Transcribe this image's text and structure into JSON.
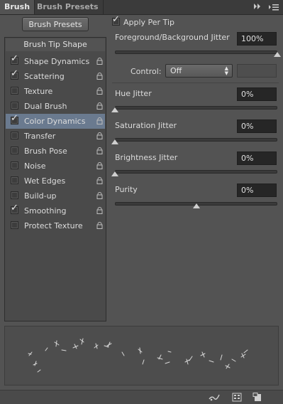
{
  "tabs": [
    {
      "label": "Brush"
    },
    {
      "label": "Brush Presets"
    }
  ],
  "header_icons": [
    "collapse-icon",
    "panel-menu-icon"
  ],
  "brush_presets_button": "Brush Presets",
  "list": {
    "header": "Brush Tip Shape",
    "items": [
      {
        "label": "Shape Dynamics",
        "checked": true,
        "selected": false
      },
      {
        "label": "Scattering",
        "checked": true,
        "selected": false
      },
      {
        "label": "Texture",
        "checked": false,
        "selected": false
      },
      {
        "label": "Dual Brush",
        "checked": false,
        "selected": false
      },
      {
        "label": "Color Dynamics",
        "checked": true,
        "selected": true
      },
      {
        "label": "Transfer",
        "checked": false,
        "selected": false
      },
      {
        "label": "Brush Pose",
        "checked": false,
        "selected": false
      },
      {
        "label": "Noise",
        "checked": false,
        "selected": false
      },
      {
        "label": "Wet Edges",
        "checked": false,
        "selected": false
      },
      {
        "label": "Build-up",
        "checked": false,
        "selected": false
      },
      {
        "label": "Smoothing",
        "checked": true,
        "selected": false
      },
      {
        "label": "Protect Texture",
        "checked": false,
        "selected": false
      }
    ]
  },
  "apply_per_tip": {
    "label": "Apply Per Tip",
    "checked": true
  },
  "fg_bg_jitter": {
    "label": "Foreground/Background Jitter",
    "value": "100%",
    "level": 1.0
  },
  "control": {
    "label": "Control:",
    "selected": "Off"
  },
  "hue_jitter": {
    "label": "Hue Jitter",
    "value": "0%",
    "level": 0.0
  },
  "saturation_jitter": {
    "label": "Saturation Jitter",
    "value": "0%",
    "level": 0.0
  },
  "brightness_jitter": {
    "label": "Brightness Jitter",
    "value": "0%",
    "level": 0.0
  },
  "purity": {
    "label": "Purity",
    "value": "0%",
    "level": 0.5
  },
  "footer_icons": [
    "toggle-live-tip-icon",
    "brush-grid-icon",
    "create-new-brush-icon"
  ],
  "colors": {
    "selected_row": "#6a7a8f",
    "panel_bg": "#535353"
  }
}
